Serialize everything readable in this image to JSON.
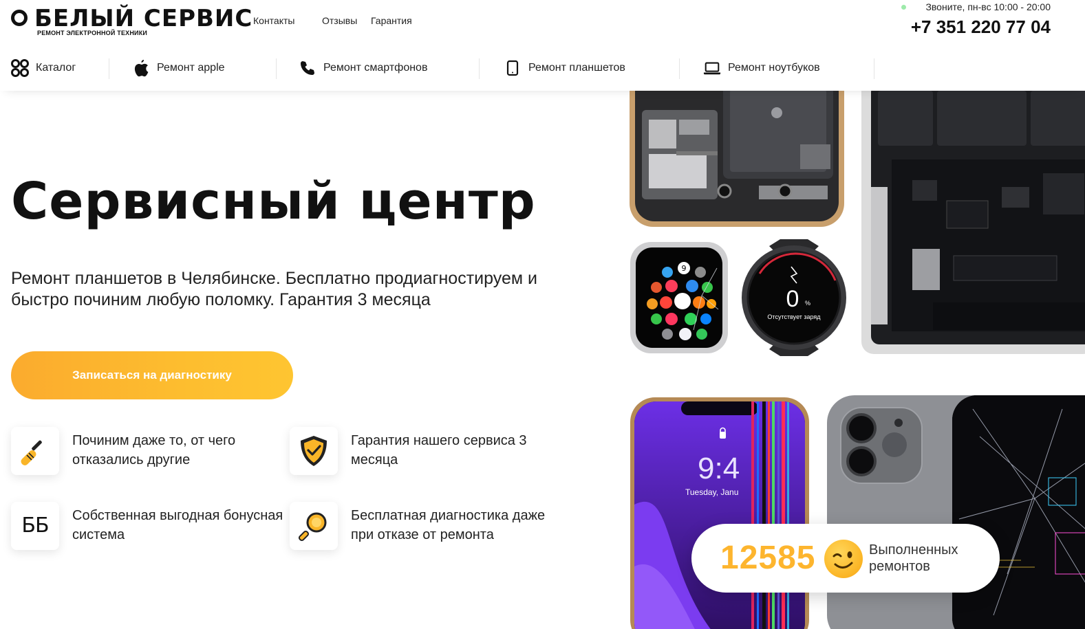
{
  "header": {
    "logo_title": "БЕЛЫЙ СЕРВИС",
    "logo_subtitle": "РЕМОНТ ЭЛЕКТРОННОЙ ТЕХНИКИ",
    "links": [
      "Контакты",
      "Отзывы",
      "Гарантия"
    ],
    "hours": "Звоните, пн-вс 10:00 - 20:00",
    "phone": "+7 351 220 77 04"
  },
  "nav": {
    "items": [
      {
        "label": "Каталог",
        "icon": "catalog-grid-icon"
      },
      {
        "label": "Ремонт apple",
        "icon": "apple-icon"
      },
      {
        "label": "Ремонт смартфонов",
        "icon": "phone-handset-icon"
      },
      {
        "label": "Ремонт планшетов",
        "icon": "tablet-icon"
      },
      {
        "label": "Ремонт ноутбуков",
        "icon": "laptop-icon"
      }
    ]
  },
  "hero": {
    "title": "Сервисный центр",
    "subtitle": "Ремонт планшетов в Челябинске. Бесплатно продиагностируем и быстро починим любую поломку. Гарантия 3 месяца",
    "cta_label": "Записаться на диагностику"
  },
  "features": [
    {
      "text": "Починим даже то, от чего отказались другие",
      "icon": "screwdriver-icon"
    },
    {
      "text": "Гарантия нашего сервиса 3 месяца",
      "icon": "shield-check-icon"
    },
    {
      "text": "Собственная выгодная бонусная система",
      "icon": "bonus-bb-icon",
      "icon_text": "ББ"
    },
    {
      "text": "Бесплатная диагностика даже при отказе от ремонта",
      "icon": "magnifier-icon"
    }
  ],
  "collage": {
    "phone_bottom_time": "9:4",
    "phone_bottom_date": "Tuesday, Janu",
    "watch_round_value": "0",
    "watch_round_unit": "%",
    "watch_round_text": "Отсутствует заряд",
    "watch_square_badge": "9"
  },
  "counter": {
    "value": "12585",
    "label": "Выполненных ремонтов",
    "emoji": "winking-face-icon"
  },
  "colors": {
    "accent": "#fdb52e",
    "cta_gradient_start": "#fbab2e",
    "cta_gradient_end": "#fec531",
    "text": "#111111"
  }
}
